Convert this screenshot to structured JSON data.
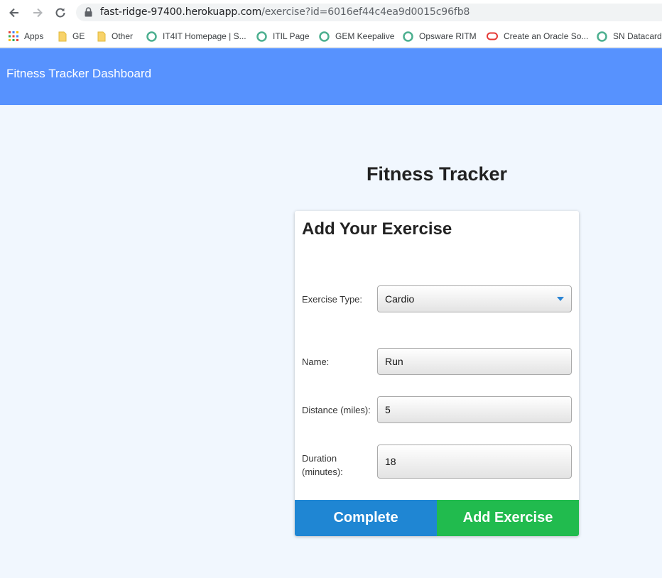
{
  "browser": {
    "url_domain": "fast-ridge-97400.herokuapp.com",
    "url_path": "/exercise?id=6016ef44c4ea9d0015c96fb8",
    "bookmarks": [
      {
        "label": "Apps",
        "icon": "apps-grid-icon"
      },
      {
        "label": "GE",
        "icon": "folder-icon"
      },
      {
        "label": "Other",
        "icon": "folder-icon"
      },
      {
        "label": "IT4IT Homepage | S...",
        "icon": "site-icon"
      },
      {
        "label": "ITIL Page",
        "icon": "site-icon"
      },
      {
        "label": "GEM Keepalive",
        "icon": "site-icon"
      },
      {
        "label": "Opsware RITM",
        "icon": "site-icon"
      },
      {
        "label": "Create an Oracle So...",
        "icon": "oracle-icon"
      },
      {
        "label": "SN Datacards",
        "icon": "site-icon"
      }
    ]
  },
  "header": {
    "title": "Fitness Tracker Dashboard"
  },
  "main": {
    "heading": "Fitness Tracker"
  },
  "form": {
    "title": "Add Your Exercise",
    "type_label": "Exercise Type:",
    "type_value": "Cardio",
    "name_label": "Name:",
    "name_value": "Run",
    "distance_label": "Distance (miles):",
    "distance_value": "5",
    "duration_label_1": "Duration",
    "duration_label_2": "(minutes):",
    "duration_value": "18",
    "complete_label": "Complete",
    "add_label": "Add Exercise"
  },
  "colors": {
    "header_bg": "#5792fe",
    "page_bg": "#f1f7fe",
    "complete_bg": "#1f86d3",
    "add_bg": "#21bb4e"
  }
}
